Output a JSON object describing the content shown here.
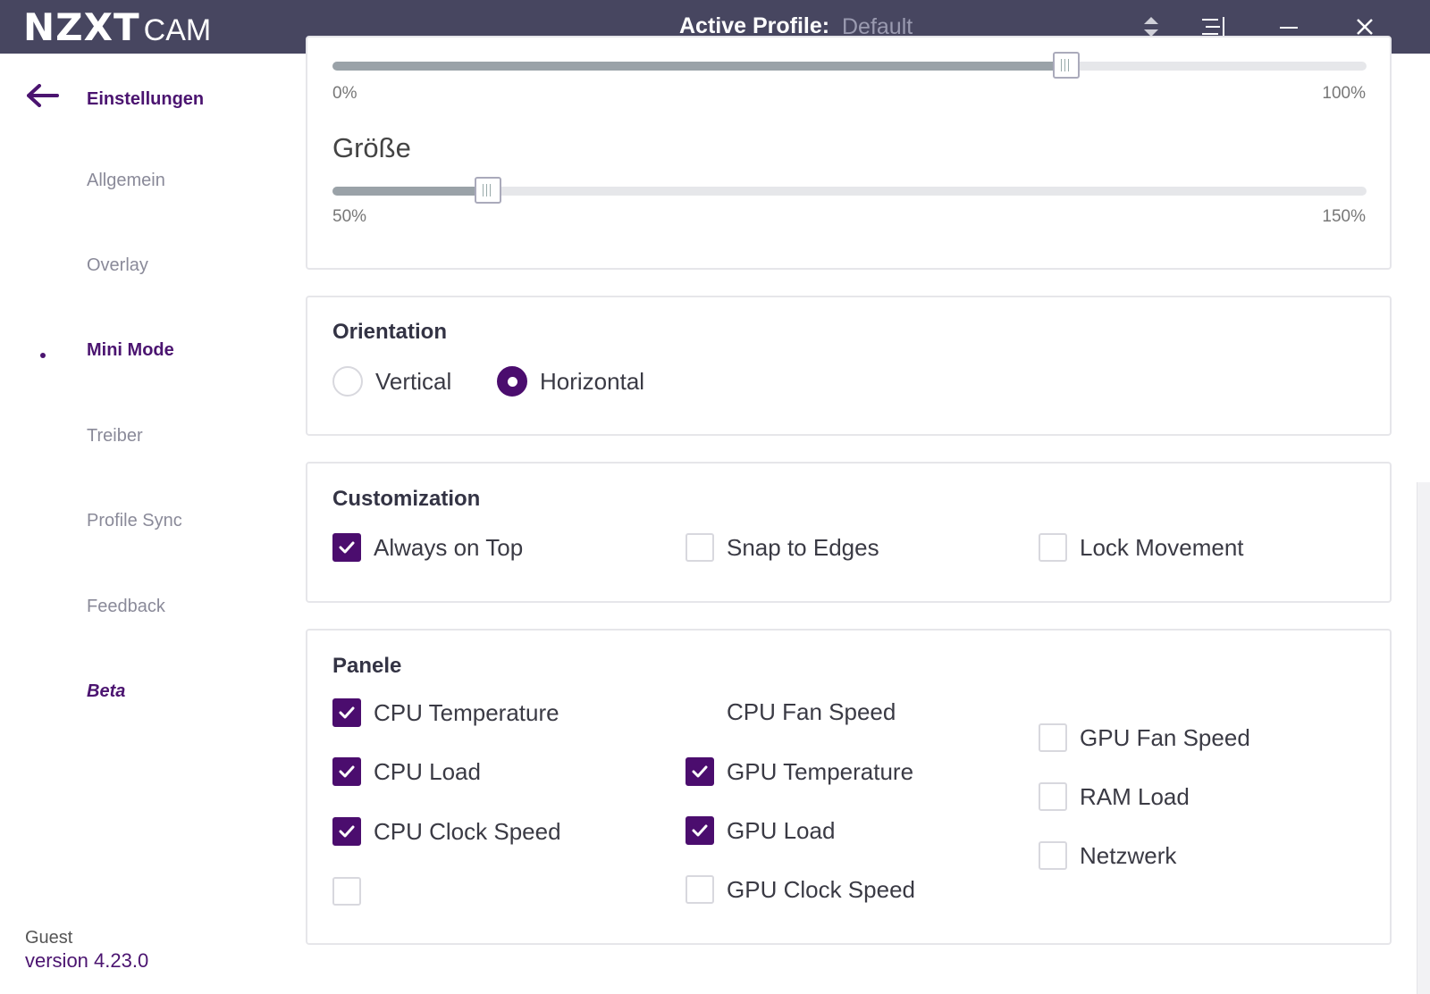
{
  "window": {
    "logo_bold": "NZXT",
    "logo_light": "CAM",
    "profile_label": "Active Profile:",
    "profile_value": "Default"
  },
  "sidebar": {
    "back_label": "Einstellungen",
    "items": [
      {
        "label": "Allgemein"
      },
      {
        "label": "Overlay"
      },
      {
        "label": "Mini Mode"
      },
      {
        "label": "Treiber"
      },
      {
        "label": "Profile Sync"
      },
      {
        "label": "Feedback"
      },
      {
        "label": "Beta"
      }
    ],
    "active_item": "Mini Mode",
    "user": "Guest",
    "version": "version 4.23.0"
  },
  "opacity_card": {
    "value_percent": 71,
    "min_label": "0%",
    "max_label": "100%"
  },
  "size_card": {
    "title": "Größe",
    "value_fraction": 0.15,
    "min_label": "50%",
    "max_label": "150%"
  },
  "orientation": {
    "title": "Orientation",
    "options": [
      "Vertical",
      "Horizontal"
    ],
    "selected": "Horizontal"
  },
  "customization": {
    "title": "Customization",
    "options": [
      {
        "label": "Always on Top",
        "checked": true
      },
      {
        "label": "Snap to Edges",
        "checked": false
      },
      {
        "label": "Lock Movement",
        "checked": false
      }
    ]
  },
  "panels": {
    "title": "Panele",
    "col1": [
      {
        "label": "CPU Temperature",
        "checked": true
      },
      {
        "label": "CPU Load",
        "checked": true
      },
      {
        "label": "CPU Clock Speed",
        "checked": true
      },
      {
        "label": "",
        "checked": false
      }
    ],
    "col2": [
      {
        "label": "CPU Fan Speed",
        "checked": false
      },
      {
        "label": "GPU Temperature",
        "checked": true
      },
      {
        "label": "GPU Load",
        "checked": true
      },
      {
        "label": "GPU Clock Speed",
        "checked": false
      }
    ],
    "col3": [
      {
        "label": "GPU Fan Speed",
        "checked": false
      },
      {
        "label": "RAM Load",
        "checked": false
      },
      {
        "label": "Netzwerk",
        "checked": false
      }
    ]
  },
  "colors": {
    "titlebar": "#474660",
    "accent": "#4b0d6e"
  }
}
